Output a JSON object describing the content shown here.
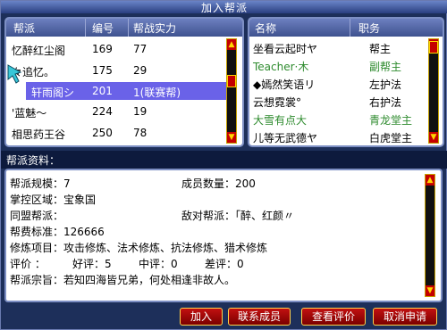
{
  "window": {
    "title": "加入帮派"
  },
  "left_table": {
    "headers": [
      "帮派",
      "编号",
      "帮战实力"
    ],
    "rows": [
      {
        "name": "忆醉红尘阁",
        "id": "169",
        "power": "77"
      },
      {
        "name": "々追忆。",
        "id": "175",
        "power": "29"
      },
      {
        "name": "轩雨阁シ",
        "id": "201",
        "power": "1(联赛帮)"
      },
      {
        "name": "'蓝魅～",
        "id": "224",
        "power": "19"
      },
      {
        "name": "相思药王谷",
        "id": "250",
        "power": "78"
      }
    ]
  },
  "right_table": {
    "headers": [
      "名称",
      "职务"
    ],
    "rows": [
      {
        "name": "坐看云起时ヤ",
        "role": "帮主",
        "color": "#000000"
      },
      {
        "name": "Teacher·木",
        "role": "副帮主",
        "color": "#2e8b2e"
      },
      {
        "name": "◆嫣然笑语リ",
        "role": "左护法",
        "color": "#000000"
      },
      {
        "name": "云想霓裳°",
        "role": "右护法",
        "color": "#000000"
      },
      {
        "name": "大雪有点大",
        "role": "青龙堂主",
        "color": "#2e8b2e"
      },
      {
        "name": "儿等无武德ヤ",
        "role": "白虎堂主",
        "color": "#000000"
      }
    ]
  },
  "info": {
    "section_title": "帮派资料：",
    "scale": "帮派规模：7",
    "members": "成员数量：200",
    "territory": "掌控区域：宝象国",
    "ally": "同盟帮派：",
    "enemy": "敌对帮派：「醉、红颜〃",
    "fee": "帮费标准：126666",
    "cultivation": "修炼项目：攻击修炼、法术修炼、抗法修炼、猎术修炼",
    "rating_label": "评价    ：",
    "good": "好评：5",
    "mid": "中评：0",
    "bad": "差评：0",
    "motto": "帮派宗旨：若知四海皆兄弟，何处相逢非故人。"
  },
  "buttons": {
    "join": "加入",
    "contact": "联系成员",
    "view_rating": "查看评价",
    "cancel": "取消申请"
  },
  "colors": {
    "accent": "#6a62e8",
    "button": "#c21010",
    "frame": "#7d8fc4",
    "green_text": "#2e8b2e"
  }
}
